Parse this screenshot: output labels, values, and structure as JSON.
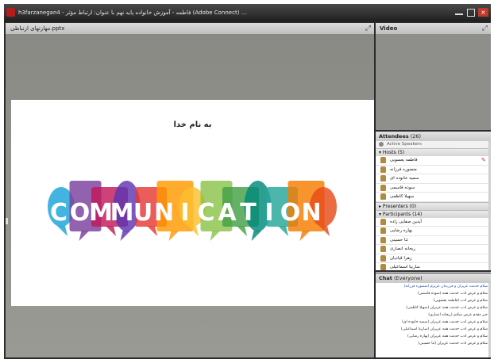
{
  "window": {
    "title": "h3farzanegan4 - فاطمه - آموزش خانواده پایه نهم با عنوان: ارتباط مؤثر (Adobe Connect) ...",
    "minimize": "",
    "maximize": "",
    "close": "×"
  },
  "share": {
    "file_name": "مهارتهای ارتباطی.pptx",
    "slide_heading": "به نام خدا",
    "logo_letters": [
      "C",
      "O",
      "M",
      "M",
      "U",
      "N",
      "I",
      "C",
      "A",
      "T",
      "I",
      "O",
      "N"
    ]
  },
  "video": {
    "title": "Video"
  },
  "attendees": {
    "title": "Attendees",
    "count": "(26)",
    "status_label": "Active Speakers",
    "hosts_label": "Hosts (5)",
    "hosts": [
      "فاطمه یعسوبی",
      "منصوره فرزانه",
      "سمیه خانوده ای",
      "سوده قاسمی",
      "سهیلا کاظمی"
    ],
    "presenters_label": "Presenters (0)",
    "participants_label": "Participants (14)",
    "participants": [
      "آیدین صفایی زاده",
      "بهاره رضایی",
      "ثنا حسینی",
      "ریحانه انصاری",
      "زهرا قبادیان",
      "سارینا اسماعیلی"
    ]
  },
  "chat": {
    "title": "Chat",
    "scope": "(Everyone)",
    "messages": [
      "سلام خدمت عزیزان و فرزندان عزیزم (منصوره فرزانه)",
      "سلام و عرض ادب خدمت همه (سوده قاسمی)",
      "سلام و عرض ادب (فاطمه یعسوبی)",
      "سلام و عرض ادب خدمت همه عزیزان (سهیلا کاظمی)",
      "خیر مقدم عرض میکنم (ریحانه انصاری)",
      "سلام و عرض ادب خدمت همه عزیزان (سمیه خانوده ای)",
      "سلام و عرض ادب خدمت همه عزیزان (سارینا اسماعیلی)",
      "سلام و عرض ادب خدمت همه عزیزان (بهاره رضایی)",
      "سلام و عرض ادب خدمت عزیزان (ثنا حسینی)"
    ]
  },
  "colors": {
    "bubble_colors": [
      "#1aa3d9",
      "#7b3f9e",
      "#c2185b",
      "#5e35b1",
      "#e53935",
      "#ff9800",
      "#fbc02d",
      "#8bc34a",
      "#43a047",
      "#00897b",
      "#26a69a",
      "#f57c00",
      "#e64a19"
    ]
  }
}
